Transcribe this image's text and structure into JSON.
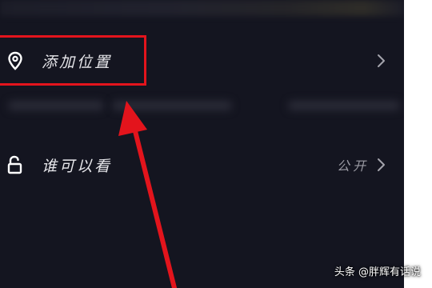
{
  "location_row": {
    "label": "添加位置",
    "icon": "location-pin-icon"
  },
  "visibility_row": {
    "label": "谁可以看",
    "value": "公开",
    "icon": "unlock-icon"
  },
  "watermark": {
    "text": "头条 @胖辉有话说"
  },
  "colors": {
    "background": "#141520",
    "highlight": "#e3141c",
    "text": "#e6e6ea",
    "muted_text": "#9a9aa3"
  }
}
